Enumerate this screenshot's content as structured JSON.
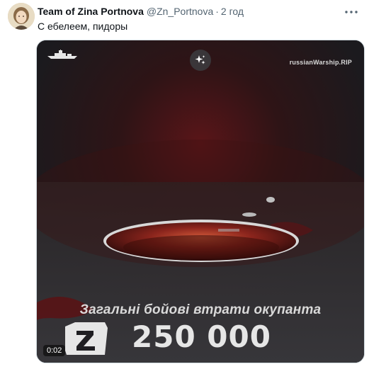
{
  "author": {
    "name": "Team of Zina Portnova",
    "handle": "@Zn_Portnova",
    "separator": "·",
    "time": "2 год"
  },
  "tweet": {
    "text": "С ебелеем, пидоры"
  },
  "media": {
    "watermark": "russianWarship.RIP",
    "headline": "Загальні бойові втрати окупанта",
    "count": "250 000",
    "duration": "0:02"
  },
  "icons": {
    "more": "more-icon",
    "ai": "sparkle-icon",
    "ship": "warship-icon",
    "z": "z-symbol-icon",
    "avatar": "avatar-portrait"
  },
  "colors": {
    "text_primary": "#0f1419",
    "text_secondary": "#536471",
    "media_bg": "#1f1e22",
    "hole_red": "#9e2a22"
  }
}
